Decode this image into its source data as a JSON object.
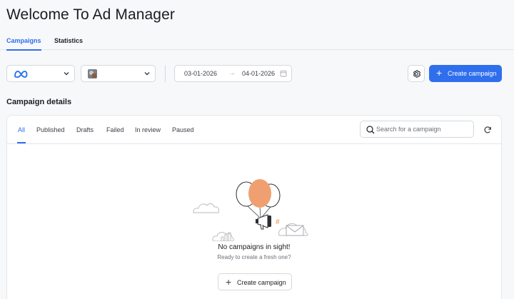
{
  "page": {
    "title": "Welcome To Ad Manager"
  },
  "top_tabs": [
    {
      "label": "Campaigns",
      "active": true
    },
    {
      "label": "Statistics",
      "active": false
    }
  ],
  "toolbar": {
    "platform_dropdown": {
      "icon": "meta-logo-icon"
    },
    "account_dropdown": {
      "icon": "account-avatar"
    },
    "date_range": {
      "start": "03-01-2026",
      "end": "04-01-2026",
      "arrow": "→"
    },
    "create_button": {
      "icon": "+",
      "label": "Create campaign"
    }
  },
  "section": {
    "title": "Campaign details"
  },
  "filter_tabs": [
    {
      "label": "All",
      "active": true
    },
    {
      "label": "Published",
      "active": false
    },
    {
      "label": "Drafts",
      "active": false
    },
    {
      "label": "Failed",
      "active": false
    },
    {
      "label": "In review",
      "active": false
    },
    {
      "label": "Paused",
      "active": false
    }
  ],
  "search": {
    "placeholder": "Search for a campaign",
    "value": ""
  },
  "empty_state": {
    "title": "No campaigns in sight!",
    "subtitle": "Ready to create a fresh one?",
    "button_icon": "+",
    "button_label": "Create campaign",
    "hash_symbol": "#"
  },
  "colors": {
    "accent": "#2f6fed",
    "balloon": "#f0a070",
    "background": "#f7f8fa"
  }
}
